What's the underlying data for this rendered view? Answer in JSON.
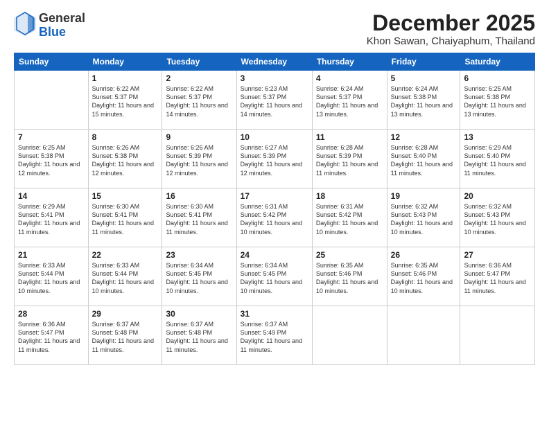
{
  "header": {
    "logo_line1": "General",
    "logo_line2": "Blue",
    "month": "December 2025",
    "location": "Khon Sawan, Chaiyaphum, Thailand"
  },
  "weekdays": [
    "Sunday",
    "Monday",
    "Tuesday",
    "Wednesday",
    "Thursday",
    "Friday",
    "Saturday"
  ],
  "weeks": [
    [
      {
        "day": "",
        "info": ""
      },
      {
        "day": "1",
        "info": "Sunrise: 6:22 AM\nSunset: 5:37 PM\nDaylight: 11 hours\nand 15 minutes."
      },
      {
        "day": "2",
        "info": "Sunrise: 6:22 AM\nSunset: 5:37 PM\nDaylight: 11 hours\nand 14 minutes."
      },
      {
        "day": "3",
        "info": "Sunrise: 6:23 AM\nSunset: 5:37 PM\nDaylight: 11 hours\nand 14 minutes."
      },
      {
        "day": "4",
        "info": "Sunrise: 6:24 AM\nSunset: 5:37 PM\nDaylight: 11 hours\nand 13 minutes."
      },
      {
        "day": "5",
        "info": "Sunrise: 6:24 AM\nSunset: 5:38 PM\nDaylight: 11 hours\nand 13 minutes."
      },
      {
        "day": "6",
        "info": "Sunrise: 6:25 AM\nSunset: 5:38 PM\nDaylight: 11 hours\nand 13 minutes."
      }
    ],
    [
      {
        "day": "7",
        "info": "Sunrise: 6:25 AM\nSunset: 5:38 PM\nDaylight: 11 hours\nand 12 minutes."
      },
      {
        "day": "8",
        "info": "Sunrise: 6:26 AM\nSunset: 5:38 PM\nDaylight: 11 hours\nand 12 minutes."
      },
      {
        "day": "9",
        "info": "Sunrise: 6:26 AM\nSunset: 5:39 PM\nDaylight: 11 hours\nand 12 minutes."
      },
      {
        "day": "10",
        "info": "Sunrise: 6:27 AM\nSunset: 5:39 PM\nDaylight: 11 hours\nand 12 minutes."
      },
      {
        "day": "11",
        "info": "Sunrise: 6:28 AM\nSunset: 5:39 PM\nDaylight: 11 hours\nand 11 minutes."
      },
      {
        "day": "12",
        "info": "Sunrise: 6:28 AM\nSunset: 5:40 PM\nDaylight: 11 hours\nand 11 minutes."
      },
      {
        "day": "13",
        "info": "Sunrise: 6:29 AM\nSunset: 5:40 PM\nDaylight: 11 hours\nand 11 minutes."
      }
    ],
    [
      {
        "day": "14",
        "info": "Sunrise: 6:29 AM\nSunset: 5:41 PM\nDaylight: 11 hours\nand 11 minutes."
      },
      {
        "day": "15",
        "info": "Sunrise: 6:30 AM\nSunset: 5:41 PM\nDaylight: 11 hours\nand 11 minutes."
      },
      {
        "day": "16",
        "info": "Sunrise: 6:30 AM\nSunset: 5:41 PM\nDaylight: 11 hours\nand 11 minutes."
      },
      {
        "day": "17",
        "info": "Sunrise: 6:31 AM\nSunset: 5:42 PM\nDaylight: 11 hours\nand 10 minutes."
      },
      {
        "day": "18",
        "info": "Sunrise: 6:31 AM\nSunset: 5:42 PM\nDaylight: 11 hours\nand 10 minutes."
      },
      {
        "day": "19",
        "info": "Sunrise: 6:32 AM\nSunset: 5:43 PM\nDaylight: 11 hours\nand 10 minutes."
      },
      {
        "day": "20",
        "info": "Sunrise: 6:32 AM\nSunset: 5:43 PM\nDaylight: 11 hours\nand 10 minutes."
      }
    ],
    [
      {
        "day": "21",
        "info": "Sunrise: 6:33 AM\nSunset: 5:44 PM\nDaylight: 11 hours\nand 10 minutes."
      },
      {
        "day": "22",
        "info": "Sunrise: 6:33 AM\nSunset: 5:44 PM\nDaylight: 11 hours\nand 10 minutes."
      },
      {
        "day": "23",
        "info": "Sunrise: 6:34 AM\nSunset: 5:45 PM\nDaylight: 11 hours\nand 10 minutes."
      },
      {
        "day": "24",
        "info": "Sunrise: 6:34 AM\nSunset: 5:45 PM\nDaylight: 11 hours\nand 10 minutes."
      },
      {
        "day": "25",
        "info": "Sunrise: 6:35 AM\nSunset: 5:46 PM\nDaylight: 11 hours\nand 10 minutes."
      },
      {
        "day": "26",
        "info": "Sunrise: 6:35 AM\nSunset: 5:46 PM\nDaylight: 11 hours\nand 10 minutes."
      },
      {
        "day": "27",
        "info": "Sunrise: 6:36 AM\nSunset: 5:47 PM\nDaylight: 11 hours\nand 11 minutes."
      }
    ],
    [
      {
        "day": "28",
        "info": "Sunrise: 6:36 AM\nSunset: 5:47 PM\nDaylight: 11 hours\nand 11 minutes."
      },
      {
        "day": "29",
        "info": "Sunrise: 6:37 AM\nSunset: 5:48 PM\nDaylight: 11 hours\nand 11 minutes."
      },
      {
        "day": "30",
        "info": "Sunrise: 6:37 AM\nSunset: 5:48 PM\nDaylight: 11 hours\nand 11 minutes."
      },
      {
        "day": "31",
        "info": "Sunrise: 6:37 AM\nSunset: 5:49 PM\nDaylight: 11 hours\nand 11 minutes."
      },
      {
        "day": "",
        "info": ""
      },
      {
        "day": "",
        "info": ""
      },
      {
        "day": "",
        "info": ""
      }
    ]
  ]
}
